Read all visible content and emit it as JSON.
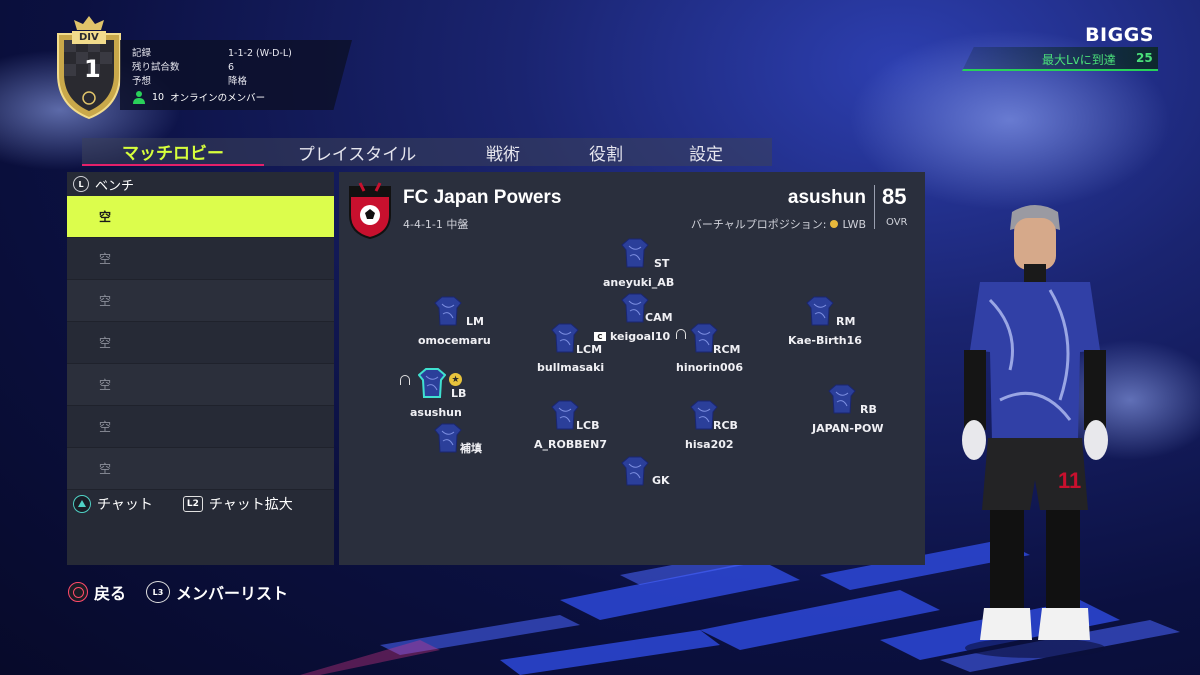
{
  "division": {
    "badge_label": "DIV",
    "badge_number": "1",
    "rows": [
      {
        "key": "記録",
        "value": "1-1-2 (W-D-L)"
      },
      {
        "key": "残り試合数",
        "value": "6"
      },
      {
        "key": "予想",
        "value": "降格"
      }
    ],
    "online_count": "10",
    "online_label": "オンラインのメンバー"
  },
  "profile": {
    "name": "BIGGS",
    "level_label": "最大Lvに到達",
    "level": "25"
  },
  "tabs": [
    {
      "label": "マッチロビー",
      "active": true
    },
    {
      "label": "プレイスタイル",
      "active": false
    },
    {
      "label": "戦術",
      "active": false
    },
    {
      "label": "役割",
      "active": false
    },
    {
      "label": "設定",
      "active": false
    }
  ],
  "bench": {
    "stick_label": "L",
    "title": "ベンチ",
    "slots": [
      "空",
      "空",
      "空",
      "空",
      "空",
      "空",
      "空"
    ],
    "chat_label": "チャット",
    "l2_label": "L2",
    "chat_expand_label": "チャット拡大"
  },
  "team": {
    "name": "FC Japan Powers",
    "formation": "4-4-1-1 中盤",
    "user": "asushun",
    "virtual_position_label": "バーチャルプロポジション:",
    "virtual_position": "LWB",
    "ovr": "85",
    "ovr_label": "OVR"
  },
  "players": [
    {
      "pos": "ST",
      "name": "aneyuki_AB"
    },
    {
      "pos": "CAM",
      "name": "keigoal10",
      "captain": "C"
    },
    {
      "pos": "LM",
      "name": "omocemaru"
    },
    {
      "pos": "LCM",
      "name": "bullmasaki"
    },
    {
      "pos": "RCM",
      "name": "hinorin006"
    },
    {
      "pos": "RM",
      "name": "Kae-Birth16"
    },
    {
      "pos": "LB",
      "name": "asushun",
      "highlight": true
    },
    {
      "pos": "LCB",
      "name": "A_ROBBEN7"
    },
    {
      "pos": "RCB",
      "name": "hisa202"
    },
    {
      "pos": "RB",
      "name": "JAPAN-POW"
    },
    {
      "pos": "",
      "name": "補填"
    },
    {
      "pos": "GK",
      "name": ""
    }
  ],
  "controls": {
    "back_label": "戻る",
    "l3_label": "L3",
    "member_list_label": "メンバーリスト"
  },
  "colors": {
    "accent_lime": "#dcfd4c",
    "tab_underline": "#e4206a",
    "level_green": "#28d05a",
    "panel": "#2a2f3d",
    "jersey": "#2b3f9a"
  },
  "icons": [
    "division-badge-icon",
    "person-icon",
    "l-stick-icon",
    "triangle-button-icon",
    "l2-button-icon",
    "team-crest-icon",
    "jersey-icon",
    "headset-icon",
    "captain-icon",
    "star-icon",
    "circle-button-icon",
    "l3-button-icon"
  ]
}
